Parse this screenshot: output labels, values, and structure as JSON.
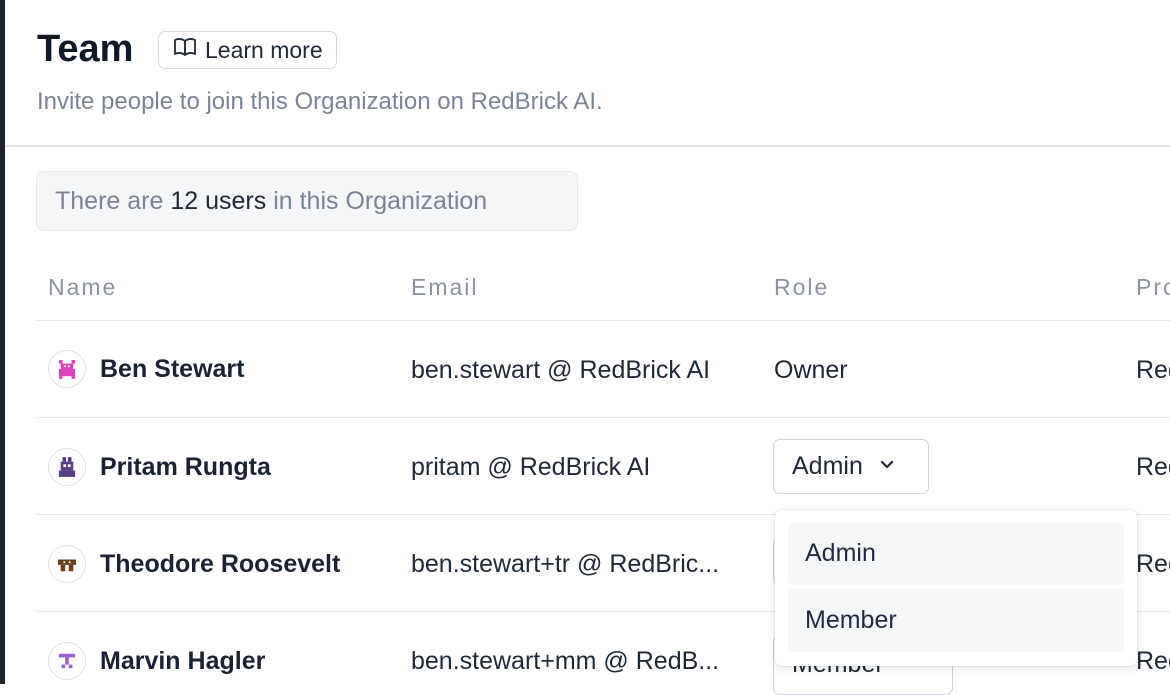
{
  "header": {
    "title": "Team",
    "learn_more": "Learn more",
    "subtitle": "Invite people to join this Organization on RedBrick AI."
  },
  "summary": {
    "prefix": "There are",
    "count": "12 users",
    "suffix": "in this Organization"
  },
  "table": {
    "columns": [
      "Name",
      "Email",
      "Role",
      "Pro"
    ],
    "rows": [
      {
        "name": "Ben Stewart",
        "email": "ben.stewart @ RedBrick AI",
        "role": "Owner",
        "projects": "Red",
        "avatar_color": "#d946b8"
      },
      {
        "name": "Pritam Rungta",
        "email": "pritam @ RedBrick AI",
        "role": "Admin",
        "projects": "Red",
        "avatar_color": "#5b3f86"
      },
      {
        "name": "Theodore Roosevelt",
        "email": "ben.stewart+tr @ RedBric...",
        "role": "",
        "projects": "Red",
        "avatar_color": "#6b3f1a"
      },
      {
        "name": "Marvin Hagler",
        "email": "ben.stewart+mm @ RedB...",
        "role": "Member",
        "projects": "Red",
        "avatar_color": "#9b5fd0"
      }
    ]
  },
  "role_dropdown": {
    "options": [
      "Admin",
      "Member"
    ]
  }
}
